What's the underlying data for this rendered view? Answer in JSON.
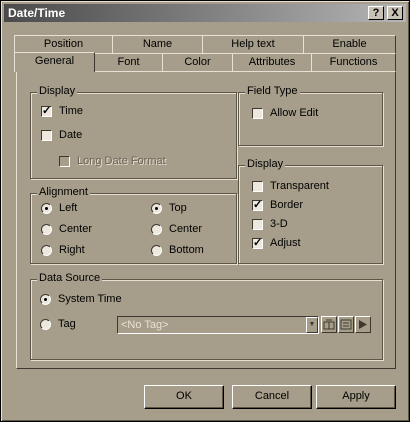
{
  "window": {
    "title": "Date/Time",
    "help_button": "?",
    "close_button": "X"
  },
  "tabs": {
    "row_back": [
      "Position",
      "Name",
      "Help text",
      "Enable"
    ],
    "row_front": [
      "General",
      "Font",
      "Color",
      "Attributes",
      "Functions"
    ],
    "active": "General"
  },
  "display_group": {
    "title": "Display",
    "time": {
      "label": "Time",
      "checked": true
    },
    "date": {
      "label": "Date",
      "checked": false
    },
    "long_date_format": {
      "label": "Long Date Format",
      "checked": false,
      "enabled": false
    }
  },
  "field_type_group": {
    "title": "Field Type",
    "allow_edit": {
      "label": "Allow Edit",
      "checked": false
    }
  },
  "display_right_group": {
    "title": "Display",
    "transparent": {
      "label": "Transparent",
      "checked": false
    },
    "border": {
      "label": "Border",
      "checked": true
    },
    "three_d": {
      "label": "3-D",
      "checked": false
    },
    "adjust": {
      "label": "Adjust",
      "checked": true
    }
  },
  "alignment_group": {
    "title": "Alignment",
    "horizontal": [
      {
        "label": "Left",
        "selected": true
      },
      {
        "label": "Center",
        "selected": false
      },
      {
        "label": "Right",
        "selected": false
      }
    ],
    "vertical": [
      {
        "label": "Top",
        "selected": true
      },
      {
        "label": "Center",
        "selected": false
      },
      {
        "label": "Bottom",
        "selected": false
      }
    ]
  },
  "data_source_group": {
    "title": "Data Source",
    "system_time": {
      "label": "System Time",
      "selected": true
    },
    "tag": {
      "label": "Tag",
      "selected": false
    },
    "tag_value": "<No Tag>"
  },
  "buttons": {
    "ok": "OK",
    "cancel": "Cancel",
    "apply": "Apply"
  },
  "colors": {
    "face": "#a69e8b",
    "highlight": "#e7e1d3",
    "shadow": "#3d392f"
  }
}
